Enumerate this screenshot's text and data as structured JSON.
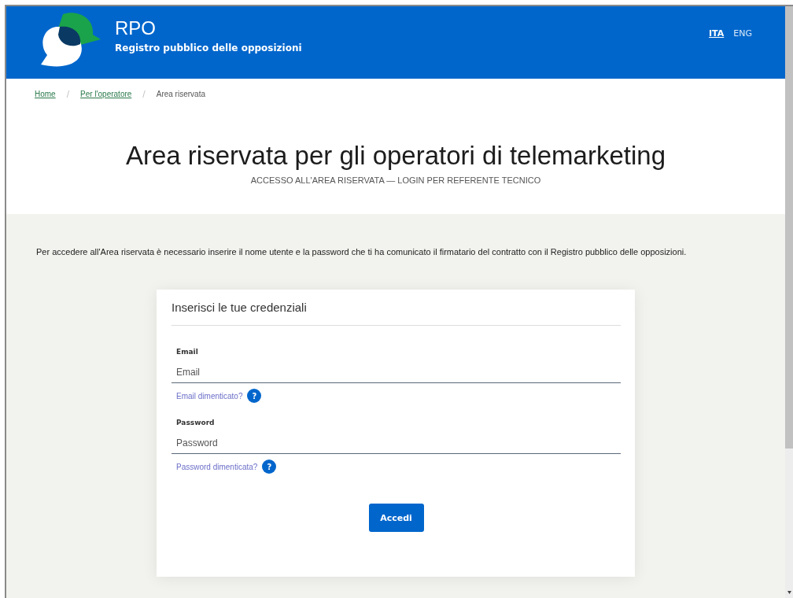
{
  "header": {
    "title": "RPO",
    "subtitle": "Registro pubblico delle opposizioni",
    "languages": [
      {
        "label": "ITA",
        "selected": true
      },
      {
        "label": "ENG",
        "selected": false
      }
    ]
  },
  "breadcrumb": [
    {
      "label": "Home",
      "link": true
    },
    {
      "label": "Per l'operatore",
      "link": true
    },
    {
      "label": "Area riservata",
      "link": false
    }
  ],
  "breadcrumb_separator": "/",
  "page_title": "Area riservata per gli operatori di telemarketing",
  "page_subtitle": "ACCESSO ALL'AREA RISERVATA — LOGIN PER REFERENTE TECNICO",
  "intro": "Per accedere all'Area riservata è necessario inserire il nome utente e la password che ti ha comunicato il firmatario del contratto con il Registro pubblico delle opposizioni.",
  "login_card": {
    "title": "Inserisci le tue credenziali",
    "fields": [
      {
        "label": "Email",
        "placeholder": "Email",
        "help_link": "Email dimenticato?",
        "help_icon": "?"
      },
      {
        "label": "Password",
        "placeholder": "Password",
        "help_link": "Password dimenticata?",
        "help_icon": "?"
      }
    ],
    "submit": "Accedi"
  }
}
